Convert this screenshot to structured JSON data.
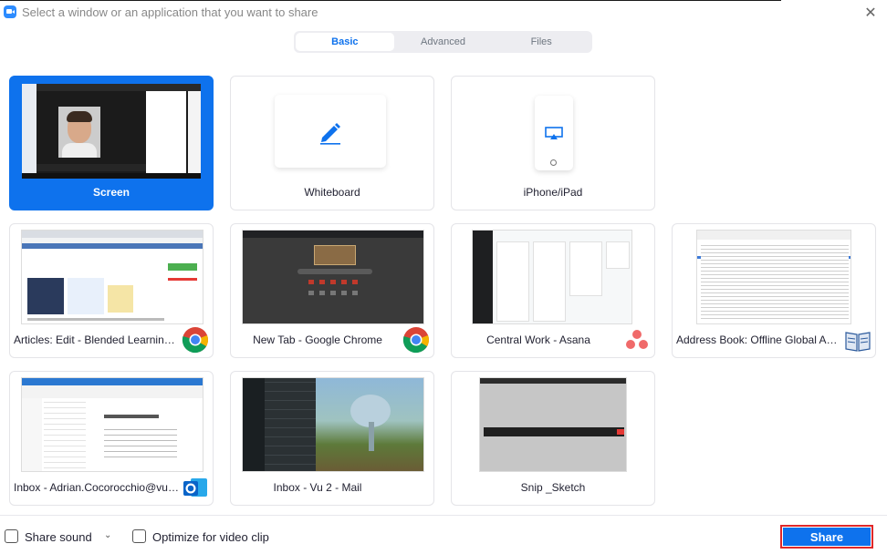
{
  "window": {
    "title": "Select a window or an application that you want to share",
    "app_icon": "zoom-app-icon",
    "close_glyph": "✕"
  },
  "tabs": [
    {
      "label": "Basic",
      "active": true
    },
    {
      "label": "Advanced",
      "active": false
    },
    {
      "label": "Files",
      "active": false
    }
  ],
  "items": [
    {
      "label": "Screen",
      "selected": true
    },
    {
      "label": "Whiteboard"
    },
    {
      "label": "iPhone/iPad"
    },
    {
      "label": "Articles: Edit - Blended Learning ...",
      "badge": "chrome-icon"
    },
    {
      "label": "New Tab - Google Chrome",
      "badge": "chrome-icon"
    },
    {
      "label": "Central Work - Asana",
      "badge": "asana-icon"
    },
    {
      "label": "Address Book: Offline Global Add...",
      "badge": "address-book-icon"
    },
    {
      "label": "Inbox - Adrian.Cocorocchio@vu....",
      "badge": "outlook-icon"
    },
    {
      "label": "Inbox - Vu 2 - Mail"
    },
    {
      "label": "Snip _Sketch"
    }
  ],
  "footer": {
    "share_sound": "Share sound",
    "optimize_video": "Optimize for video clip",
    "share_button": "Share"
  },
  "colors": {
    "accent": "#0e72ed",
    "highlight_outline": "#e0282a"
  }
}
